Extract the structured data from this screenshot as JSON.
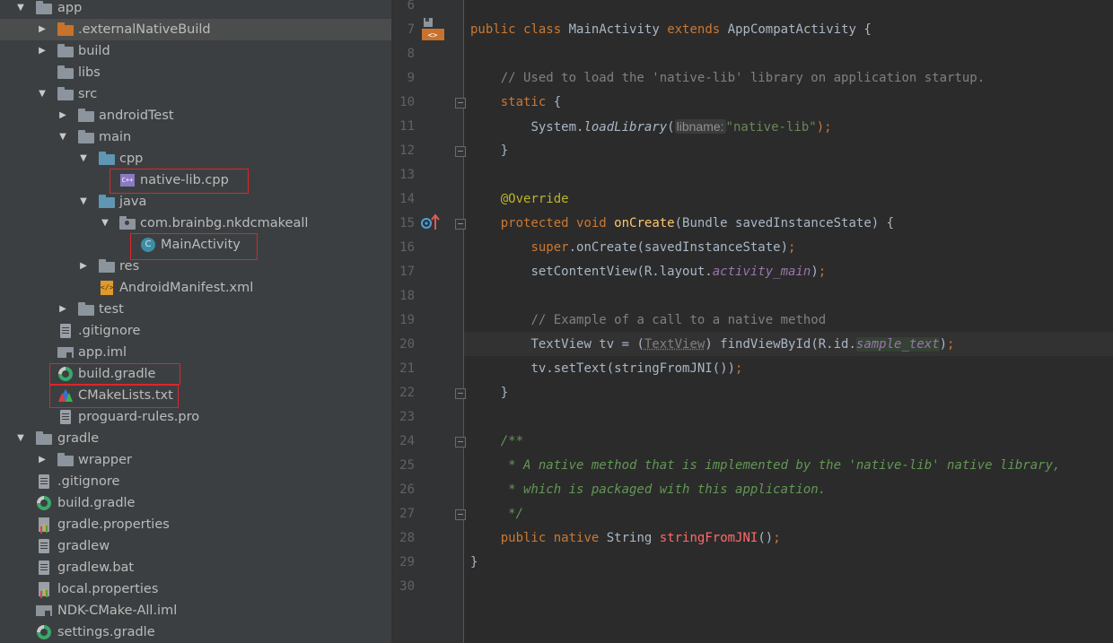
{
  "project_tree": [
    {
      "label": "app",
      "icon": "folder-icon",
      "expanded": true
    },
    {
      "label": ".externalNativeBuild",
      "icon": "folder-excluded-icon",
      "expanded": false,
      "selected": true
    },
    {
      "label": "build",
      "icon": "folder-icon",
      "expanded": false
    },
    {
      "label": "libs",
      "icon": "folder-icon"
    },
    {
      "label": "src",
      "icon": "folder-icon",
      "expanded": true
    },
    {
      "label": "androidTest",
      "icon": "folder-icon",
      "expanded": false
    },
    {
      "label": "main",
      "icon": "folder-icon",
      "expanded": true
    },
    {
      "label": "cpp",
      "icon": "source-folder-icon",
      "expanded": true
    },
    {
      "label": "native-lib.cpp",
      "icon": "cpp-file-icon",
      "highlighted": true
    },
    {
      "label": "java",
      "icon": "source-folder-icon",
      "expanded": true
    },
    {
      "label": "com.brainbg.nkdcmakeall",
      "icon": "package-icon",
      "expanded": true
    },
    {
      "label": "MainActivity",
      "icon": "java-class-icon",
      "highlighted": true
    },
    {
      "label": "res",
      "icon": "resource-folder-icon",
      "expanded": false
    },
    {
      "label": "AndroidManifest.xml",
      "icon": "xml-file-icon"
    },
    {
      "label": "test",
      "icon": "folder-icon",
      "expanded": false
    },
    {
      "label": ".gitignore",
      "icon": "text-file-icon"
    },
    {
      "label": "app.iml",
      "icon": "module-file-icon"
    },
    {
      "label": "build.gradle",
      "icon": "gradle-icon",
      "highlighted": true
    },
    {
      "label": "CMakeLists.txt",
      "icon": "cmake-icon",
      "highlighted": true
    },
    {
      "label": "proguard-rules.pro",
      "icon": "text-file-icon"
    },
    {
      "label": "gradle",
      "icon": "folder-icon",
      "expanded": true
    },
    {
      "label": "wrapper",
      "icon": "folder-icon",
      "expanded": false
    },
    {
      "label": ".gitignore",
      "icon": "text-file-icon"
    },
    {
      "label": "build.gradle",
      "icon": "gradle-icon"
    },
    {
      "label": "gradle.properties",
      "icon": "properties-file-icon"
    },
    {
      "label": "gradlew",
      "icon": "text-file-icon"
    },
    {
      "label": "gradlew.bat",
      "icon": "text-file-icon"
    },
    {
      "label": "local.properties",
      "icon": "properties-file-icon"
    },
    {
      "label": "NDK-CMake-All.iml",
      "icon": "module-file-icon"
    },
    {
      "label": "settings.gradle",
      "icon": "gradle-icon"
    }
  ],
  "editor": {
    "line_numbers": [
      "6",
      "7",
      "8",
      "9",
      "10",
      "11",
      "12",
      "13",
      "14",
      "15",
      "16",
      "17",
      "18",
      "19",
      "20",
      "21",
      "22",
      "23",
      "24",
      "25",
      "26",
      "27",
      "28",
      "29",
      "30"
    ],
    "current_line": "20",
    "code": {
      "l7": {
        "kw1": "public",
        "kw2": "class",
        "name": "MainActivity",
        "kw3": "extends",
        "parent": "AppCompatActivity",
        "brace": "{"
      },
      "l9": "// Used to load the 'native-lib' library on application startup.",
      "l10": {
        "kw": "static",
        "brace": "{"
      },
      "l11": {
        "cls": "System.",
        "method": "loadLibrary",
        "open": "(",
        "hint": "libname:",
        "str": "\"native-lib\"",
        "close": ");"
      },
      "l12": "}",
      "l14": "@Override",
      "l15": {
        "kw1": "protected",
        "kw2": "void",
        "method": "onCreate",
        "rest": "(Bundle savedInstanceState) {"
      },
      "l16": {
        "kw": "super",
        "rest": ".onCreate(savedInstanceState)",
        "semi": ";"
      },
      "l17": {
        "pre": "setContentView(R.layout.",
        "field": "activity_main",
        "post": ")",
        "semi": ";"
      },
      "l19": "// Example of a call to a native method",
      "l20": {
        "pre": "TextView tv = (",
        "cast": "TextView",
        "mid": ") findViewById(R.id.",
        "field": "sample_text",
        "post": ")",
        "semi": ";"
      },
      "l21": {
        "text": "tv.setText(stringFromJNI())",
        "semi": ";"
      },
      "l22": "}",
      "l24": "/**",
      "l25": " * A native method that is implemented by the 'native-lib' native library,",
      "l26": " * which is packaged with this application.",
      "l27": " */",
      "l28": {
        "kw1": "public",
        "kw2": "native",
        "type": "String",
        "method": "stringFromJNI",
        "rest": "()",
        "semi": ";"
      },
      "l29": "}"
    }
  }
}
